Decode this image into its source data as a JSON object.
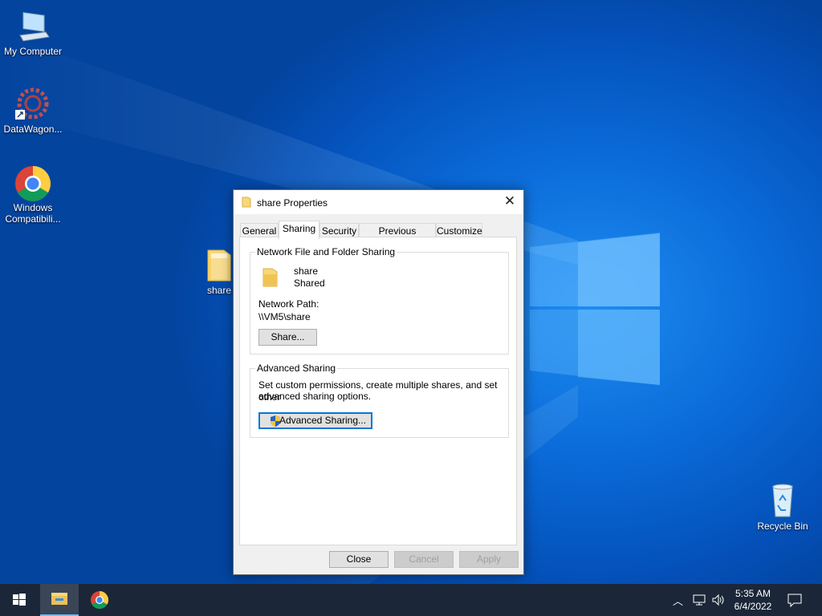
{
  "desktop": {
    "icons": [
      {
        "label": "My Computer"
      },
      {
        "label": "DataWagon..."
      },
      {
        "label": "Windows Compatibili..."
      },
      {
        "label": "share"
      },
      {
        "label": "Recycle Bin"
      }
    ]
  },
  "dialog": {
    "title": "share Properties",
    "close_glyph": "✕",
    "tabs": [
      {
        "label": "General"
      },
      {
        "label": "Sharing"
      },
      {
        "label": "Security"
      },
      {
        "label": "Previous Versions"
      },
      {
        "label": "Customize"
      }
    ],
    "active_tab": "Sharing",
    "network_sharing": {
      "legend": "Network File and Folder Sharing",
      "folder_name": "share",
      "status": "Shared",
      "path_label": "Network Path:",
      "path_value": "\\\\VM5\\share",
      "share_button": "Share..."
    },
    "advanced_sharing": {
      "legend": "Advanced Sharing",
      "description_line1": "Set custom permissions, create multiple shares, and set other",
      "description_line2": "advanced sharing options.",
      "button": "Advanced Sharing..."
    },
    "footer": {
      "close": "Close",
      "cancel": "Cancel",
      "apply": "Apply"
    }
  },
  "taskbar": {
    "time": "5:35 AM",
    "date": "6/4/2022",
    "pinned": [
      {
        "name": "file-explorer-icon"
      },
      {
        "name": "chrome-icon"
      }
    ]
  },
  "colors": {
    "desktop_blue": "#0a6ad8",
    "taskbar": "#1b2738",
    "focus_border": "#0078d7",
    "folder_yellow": "#f8d775"
  }
}
